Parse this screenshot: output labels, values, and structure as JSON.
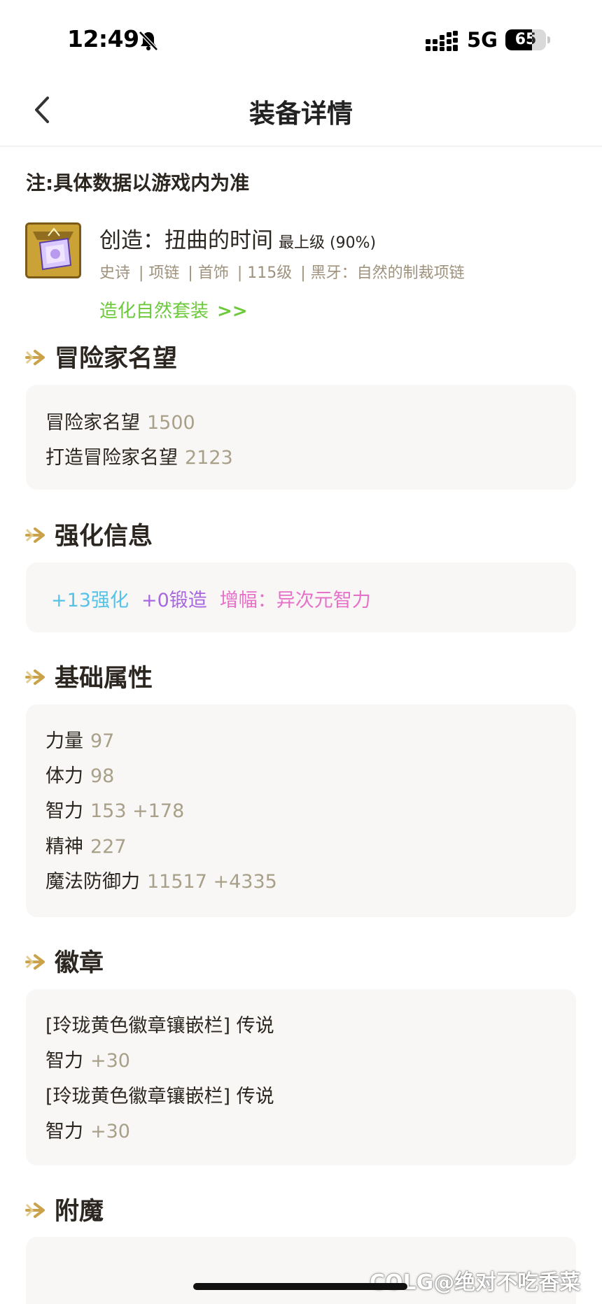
{
  "status_bar": {
    "time": "12:49",
    "network": "5G",
    "battery_level": "65",
    "battery_fill_fraction": 0.65
  },
  "nav": {
    "title": "装备详情"
  },
  "note": "注:具体数据以游戏内为准",
  "item": {
    "name": "创造：扭曲的时间",
    "grade": "最上级 (90%)",
    "tags": [
      "史诗",
      "| 项链",
      "| 首饰",
      "| 115级",
      "| 黑牙：自然的制裁项链"
    ],
    "set_link": "造化自然套装",
    "set_link_arrow": ">>"
  },
  "sections": {
    "reputation": {
      "title": "冒险家名望",
      "rows": [
        {
          "label": "冒险家名望",
          "value": "1500"
        },
        {
          "label": "打造冒险家名望",
          "value": "2123"
        }
      ]
    },
    "enhancement": {
      "title": "强化信息",
      "reinforce": "+13强化",
      "forge": "+0锻造",
      "amplify": "增幅：异次元智力"
    },
    "base_stats": {
      "title": "基础属性",
      "rows": [
        {
          "label": "力量",
          "value": "97"
        },
        {
          "label": "体力",
          "value": "98"
        },
        {
          "label": "智力",
          "value": "153 +178"
        },
        {
          "label": "精神",
          "value": "227"
        },
        {
          "label": "魔法防御力",
          "value": "11517 +4335"
        }
      ]
    },
    "emblems": {
      "title": "徽章",
      "rows": [
        {
          "label": "[玲珑黄色徽章镶嵌栏] 传说",
          "value": ""
        },
        {
          "label": "智力",
          "value": "+30"
        },
        {
          "label": "[玲珑黄色徽章镶嵌栏] 传说",
          "value": ""
        },
        {
          "label": "智力",
          "value": "+30"
        }
      ]
    },
    "enchant": {
      "title": "附魔"
    }
  },
  "watermark": "COLG@绝对不吃香菜",
  "colors": {
    "accent_gold": "#c9a24a",
    "set_green": "#6cc93a",
    "reinforce_cyan": "#55c3e8",
    "forge_purple": "#a867e0",
    "amplify_pink": "#e671c8",
    "value_gray": "#a9a089"
  }
}
